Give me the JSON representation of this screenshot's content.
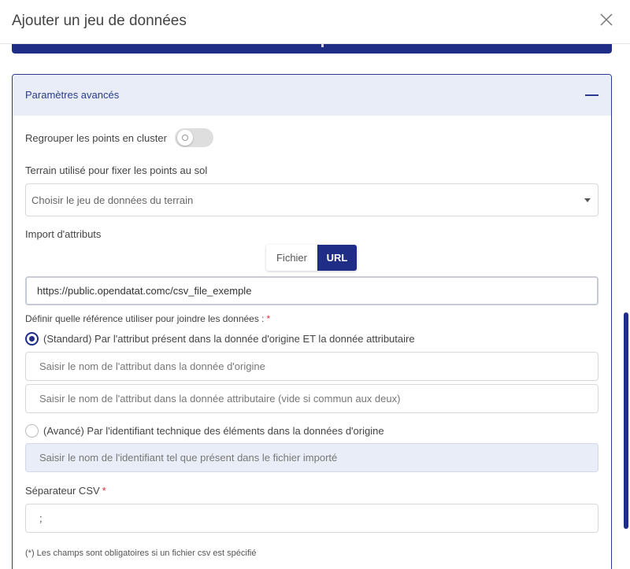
{
  "modal": {
    "title": "Ajouter un jeu de données"
  },
  "panel": {
    "title": "Paramètres avancés"
  },
  "cluster": {
    "label": "Regrouper les points en cluster"
  },
  "terrain": {
    "label": "Terrain utilisé pour fixer les points au sol",
    "selected": "Choisir le jeu de données du terrain"
  },
  "import": {
    "label": "Import d'attributs",
    "options": [
      "Fichier",
      "URL"
    ],
    "active": "URL",
    "url_value": "https://public.opendatat.comc/csv_file_exemple"
  },
  "join": {
    "label": "Définir quelle référence utiliser pour joindre les données :",
    "required_mark": "*",
    "standard": {
      "label": "(Standard) Par l'attribut présent dans la donnée d'origine ET la donnée attributaire",
      "origin_placeholder": "Saisir le nom de l'attribut dans la donnée d'origine",
      "attr_placeholder": "Saisir le nom de l'attribut dans la donnée attributaire (vide si commun aux deux)"
    },
    "advanced": {
      "label": "(Avancé) Par l'identifiant technique des éléments dans la données d'origine",
      "id_placeholder": "Saisir le nom de l'identifiant tel que présent dans le fichier importé"
    }
  },
  "csv": {
    "label": "Séparateur CSV",
    "required_mark": "*",
    "value": ";"
  },
  "footnote": "(*) Les champs sont obligatoires si un fichier csv est spécifié",
  "colors": {
    "primary": "#1f2d86",
    "panel_header_bg": "#e9edf7",
    "required": "#d0333b"
  }
}
